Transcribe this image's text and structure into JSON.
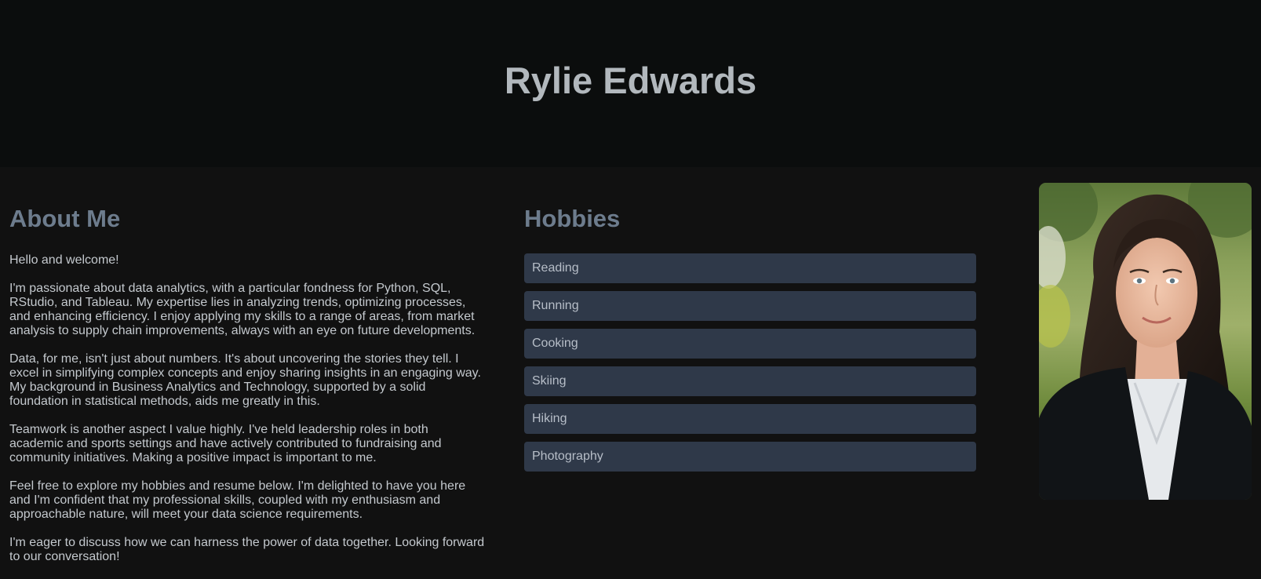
{
  "header": {
    "name": "Rylie Edwards"
  },
  "about": {
    "title": "About Me",
    "paragraphs": [
      "Hello and welcome!",
      "I'm passionate about data analytics, with a particular fondness for Python, SQL, RStudio, and Tableau. My expertise lies in analyzing trends, optimizing processes, and enhancing efficiency. I enjoy applying my skills to a range of areas, from market analysis to supply chain improvements, always with an eye on future developments.",
      "Data, for me, isn't just about numbers. It's about uncovering the stories they tell. I excel in simplifying complex concepts and enjoy sharing insights in an engaging way. My background in Business Analytics and Technology, supported by a solid foundation in statistical methods, aids me greatly in this.",
      "Teamwork is another aspect I value highly. I've held leadership roles in both academic and sports settings and have actively contributed to fundraising and community initiatives. Making a positive impact is important to me.",
      "Feel free to explore my hobbies and resume below. I'm delighted to have you here and I'm confident that my professional skills, coupled with my enthusiasm and approachable nature, will meet your data science requirements.",
      "I'm eager to discuss how we can harness the power of data together. Looking forward to our conversation!"
    ]
  },
  "hobbies": {
    "title": "Hobbies",
    "items": [
      "Reading",
      "Running",
      "Cooking",
      "Skiing",
      "Hiking",
      "Photography"
    ]
  },
  "colors": {
    "header_bg": "#0b0d0d",
    "page_bg": "#111111",
    "name_text": "#b2b8bd",
    "section_heading": "#6d7c8d",
    "body_text": "#c4c9ce",
    "hobby_bg": "#2f3949",
    "hobby_text": "#b7bec8"
  }
}
